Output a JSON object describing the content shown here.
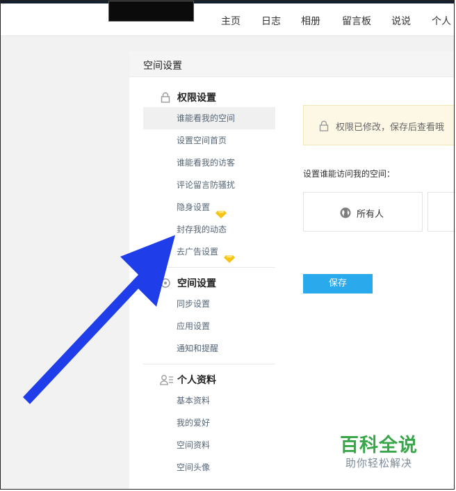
{
  "nav": {
    "items": [
      "主页",
      "日志",
      "相册",
      "留言板",
      "说说",
      "个人"
    ]
  },
  "panel": {
    "title": "空间设置"
  },
  "sidebar": {
    "sections": [
      {
        "title": "权限设置",
        "icon": "lock-icon",
        "items": [
          {
            "label": "谁能看我的空间",
            "active": true
          },
          {
            "label": "设置空间首页"
          },
          {
            "label": "谁能看我的访客"
          },
          {
            "label": "评论留言防骚扰"
          },
          {
            "label": "隐身设置",
            "badge": "diamond-icon"
          },
          {
            "label": "封存我的动态"
          },
          {
            "label": "去广告设置",
            "badge": "diamond-icon"
          }
        ]
      },
      {
        "title": "空间设置",
        "icon": "gear-icon",
        "items": [
          {
            "label": "同步设置"
          },
          {
            "label": "应用设置"
          },
          {
            "label": "通知和提醒"
          }
        ]
      },
      {
        "title": "个人资料",
        "icon": "user-profile-icon",
        "items": [
          {
            "label": "基本资料"
          },
          {
            "label": "我的爱好"
          },
          {
            "label": "空间资料"
          },
          {
            "label": "空间头像"
          }
        ]
      }
    ]
  },
  "main": {
    "notice": "权限已修改，保存后查看哦",
    "setting_label": "设置谁能访问我的空间：",
    "options": [
      {
        "label": "所有人",
        "icon": "globe-icon"
      }
    ],
    "save_label": "保存"
  },
  "watermark": {
    "main": "百科全说",
    "sub": "助你轻松解决"
  },
  "colors": {
    "accent": "#2aa9ec",
    "notice_bg": "#fdf8e5",
    "arrow": "#1f3de8",
    "watermark_green": "#3aa64a"
  }
}
